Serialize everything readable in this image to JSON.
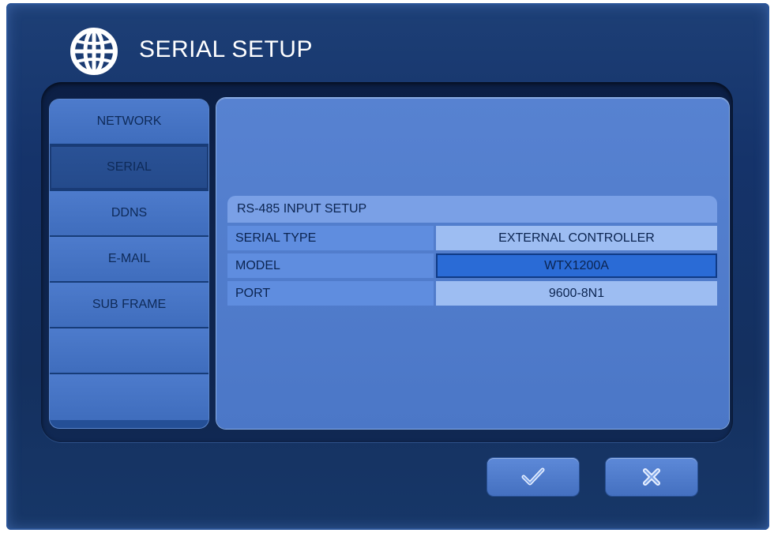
{
  "header": {
    "title": "SERIAL SETUP",
    "icon": "globe-icon"
  },
  "sidebar": {
    "items": [
      {
        "label": "NETWORK",
        "selected": false
      },
      {
        "label": "SERIAL",
        "selected": true
      },
      {
        "label": "DDNS",
        "selected": false
      },
      {
        "label": "E-MAIL",
        "selected": false
      },
      {
        "label": "SUB FRAME",
        "selected": false
      },
      {
        "label": "",
        "selected": false
      },
      {
        "label": "",
        "selected": false
      }
    ]
  },
  "section": {
    "title": "RS-485 INPUT SETUP",
    "rows": [
      {
        "label": "SERIAL TYPE",
        "value": "EXTERNAL CONTROLLER",
        "active": false
      },
      {
        "label": "MODEL",
        "value": "WTX1200A",
        "active": true
      },
      {
        "label": "PORT",
        "value": "9600-8N1",
        "active": false
      }
    ]
  },
  "buttons": {
    "ok_icon": "checkmark-icon",
    "cancel_icon": "x-icon"
  },
  "colors": {
    "background": "#15336a",
    "accent": "#2a6bd6",
    "panel": "#4b77c7"
  }
}
